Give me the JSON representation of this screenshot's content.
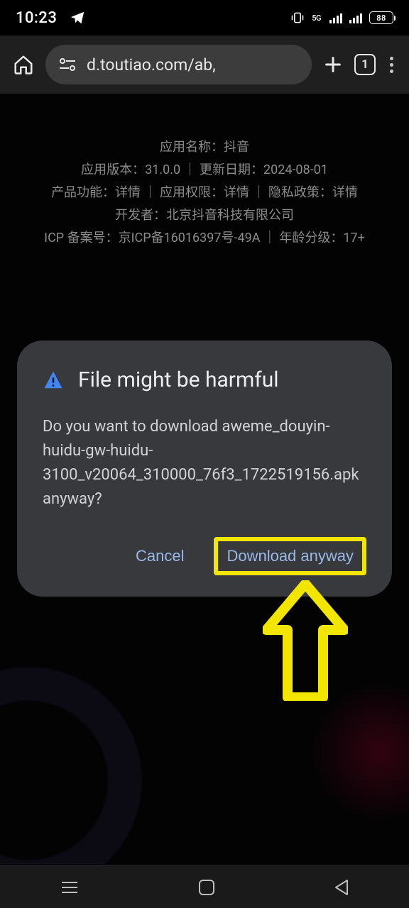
{
  "status": {
    "time": "10:23",
    "net_label": "5G",
    "battery_pct": "88"
  },
  "browser": {
    "url_display": "d.toutiao.com/ab,",
    "tab_count": "1"
  },
  "page": {
    "lines": [
      "应用名称：抖音",
      "应用版本：31.0.0 ｜ 更新日期：2024-08-01",
      "产品功能：详情 ｜ 应用权限：详情 ｜ 隐私政策：详情",
      "开发者：北京抖音科技有限公司",
      "ICP 备案号：京ICP备16016397号-49A ｜ 年龄分级：17+"
    ]
  },
  "dialog": {
    "title": "File might be harmful",
    "message": "Do you want to download aweme_douyin-huidu-gw-huidu-3100_v20064_310000_76f3_1722519156.apk anyway?",
    "cancel": "Cancel",
    "confirm": "Download anyway"
  },
  "colors": {
    "highlight": "#f2e600",
    "link": "#98b7e6"
  }
}
